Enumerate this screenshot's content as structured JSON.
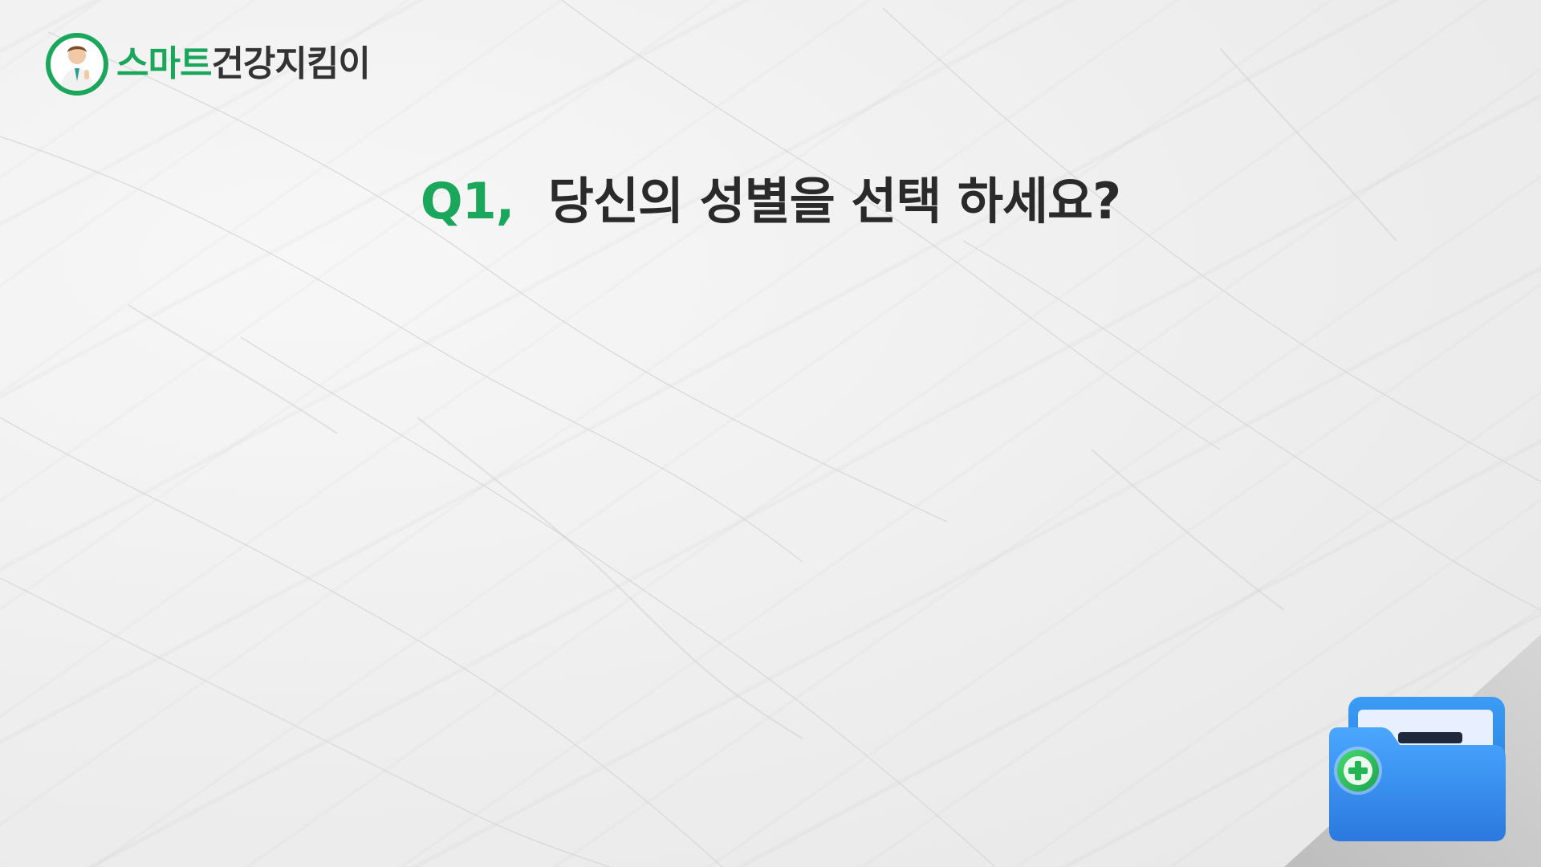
{
  "brand": {
    "name_accent": "스마트",
    "name_rest": "건강지킴이",
    "accent_color": "#1aa65b",
    "text_color": "#333333",
    "badge_icon": "doctor-avatar-icon"
  },
  "question": {
    "number": "Q1,",
    "text": "당신의 성별을 선택 하세요?"
  },
  "decor": {
    "corner_fold_color": "#c9c9c9",
    "folder_icon": "medical-folder-icon",
    "folder_color": "#2f8ff0",
    "plus_badge_color": "#28c35a"
  }
}
